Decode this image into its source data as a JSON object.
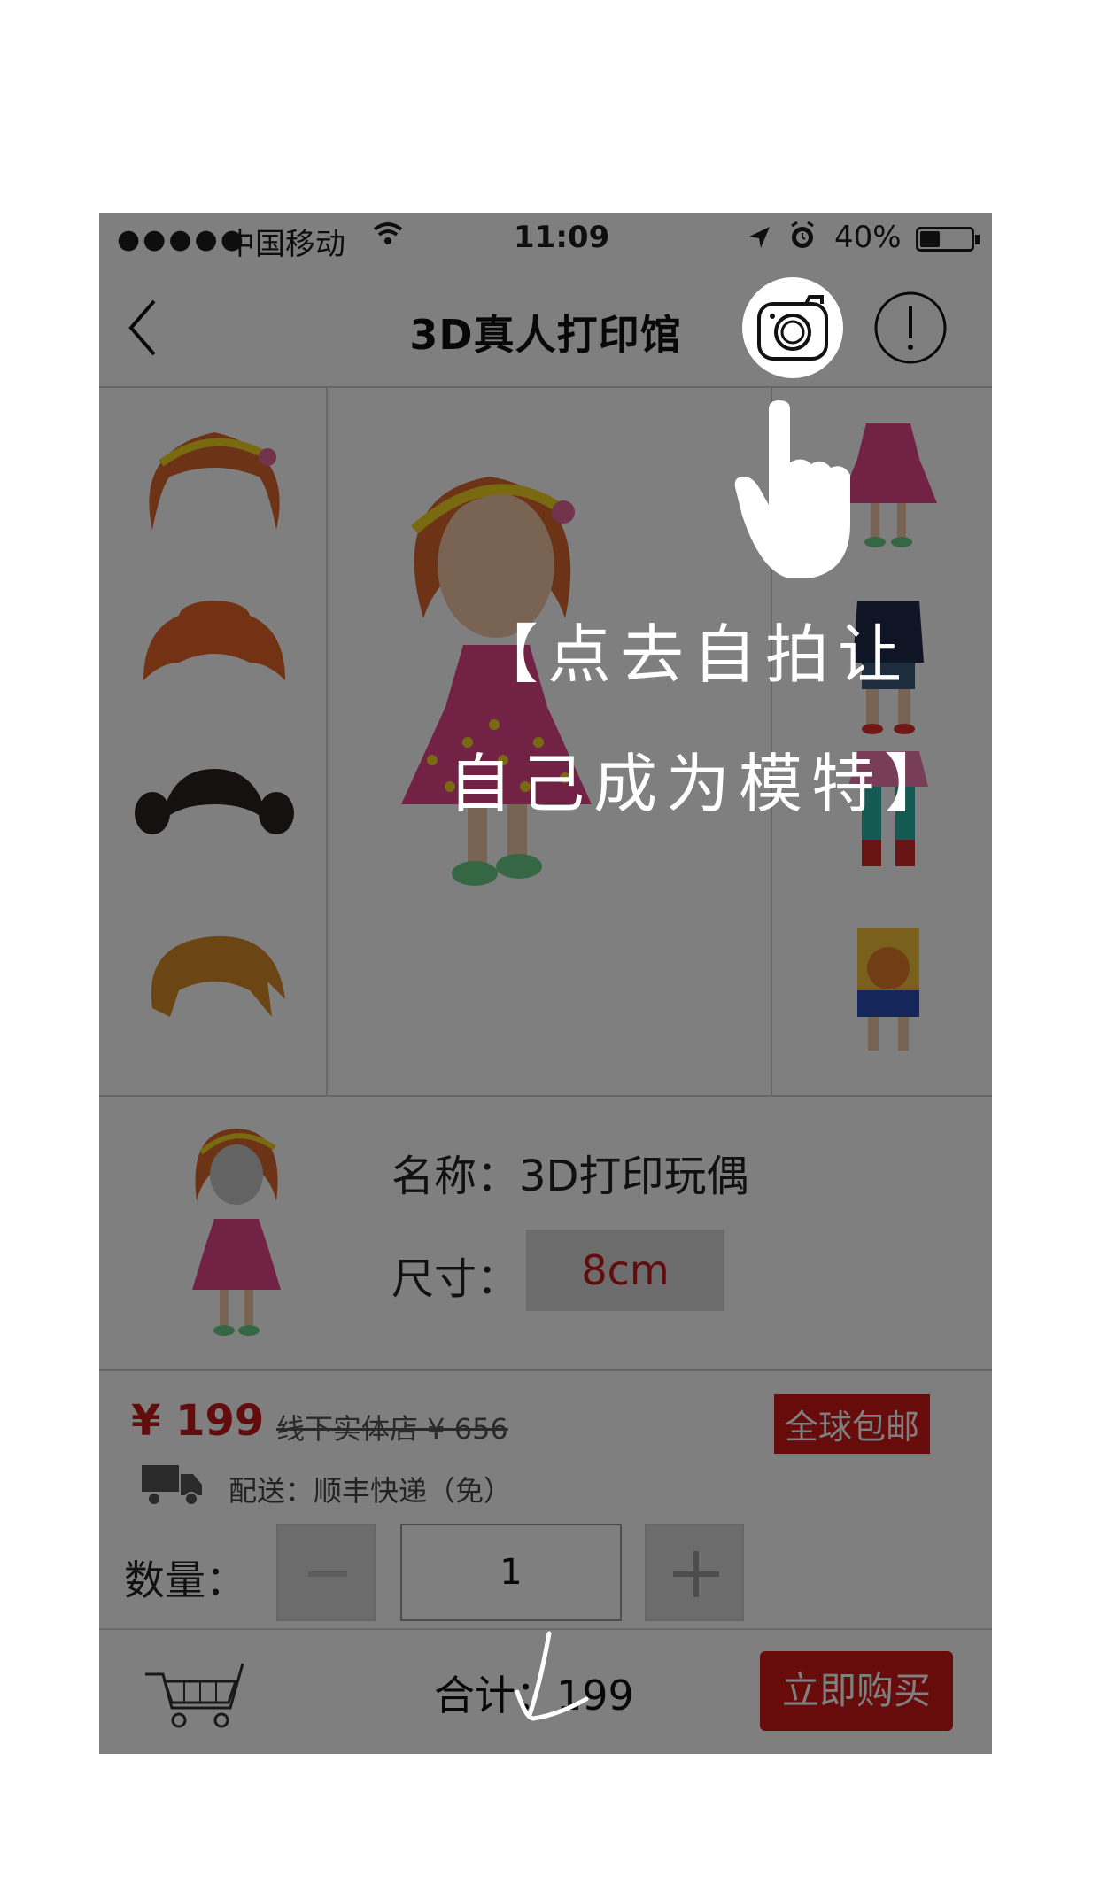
{
  "status_bar": {
    "signal": "●●●●●",
    "carrier": "中国移动",
    "time": "11:09",
    "battery": "40%",
    "battery_level": 0.4
  },
  "nav": {
    "title": "3D真人打印馆",
    "back_icon": "chevron-left-icon",
    "camera_icon": "camera-icon",
    "info_icon": "exclamation-circle-icon"
  },
  "editor": {
    "hair_options": [
      "hair-headband-bob",
      "hair-orange-bun",
      "hair-black-pigtails",
      "hair-short-spiky"
    ],
    "body_options": [
      "body-pink-dress",
      "body-school-uniform",
      "body-pink-skirt",
      "body-basketball"
    ]
  },
  "product": {
    "name_label": "名称：",
    "name_value": "3D打印玩偶",
    "size_label": "尺寸：",
    "size_value": "8cm"
  },
  "pricing": {
    "price": "¥ 199",
    "old_price": "线下实体店 ¥ 656",
    "free_shipping": "全球包邮",
    "delivery": "配送：顺丰快递（免）",
    "qty_label": "数量：",
    "qty_value": "1"
  },
  "bottom": {
    "total": "合计：199",
    "buy": "立即购买"
  },
  "hint": {
    "line1": "【点去自拍让",
    "line2": "自己成为模特】"
  },
  "colors": {
    "accent_red": "#cf1717",
    "overlay": "rgba(0,0,0,0.5)"
  }
}
